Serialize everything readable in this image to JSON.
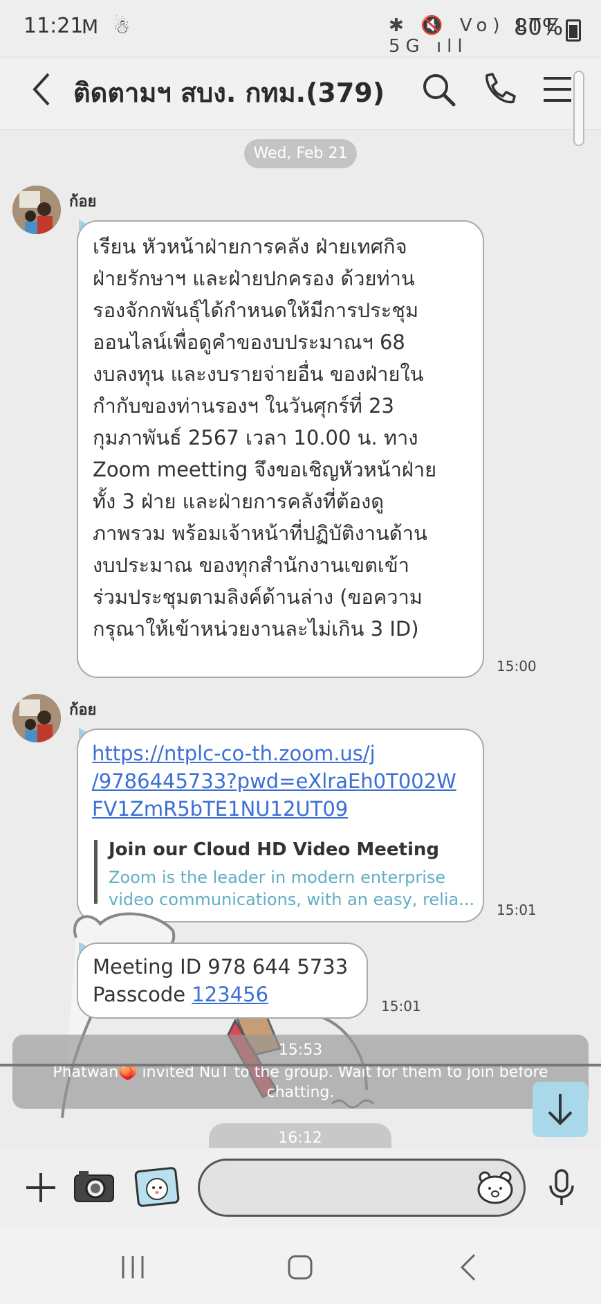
{
  "status_bar": {
    "time": "11:21",
    "left_icons": "M ☃",
    "right_icons": "✱ 🔇 Vo) LTE 5G ıll",
    "battery": "80%"
  },
  "header": {
    "title": "ติดตามฯ สบง. กทม.(379)"
  },
  "chat": {
    "date": "Wed, Feb 21",
    "messages": [
      {
        "sender": "ก้อย",
        "lines": [
          "เรียน หัวหน้าฝ่ายการคลัง  ฝ่ายเทศกิจ",
          "ฝ่ายรักษาฯ และฝ่ายปกครอง ด้วยท่าน",
          "รองจักกพันธุ์ได้กำหนดให้มีการประชุม",
          "ออนไลน์เพื่อดูคำของบประมาณฯ 68",
          "งบลงทุน และงบรายจ่ายอื่น ของฝ่ายใน",
          "กำกับของท่านรองฯ ในวันศุกร์ที่ 23",
          "กุมภาพันธ์ 2567 เวลา 10.00 น. ทาง",
          "Zoom meetting จึงขอเชิญหัวหน้าฝ่าย",
          "ทั้ง 3 ฝ่าย และฝ่ายการคลังที่ต้องดู",
          "ภาพรวม พร้อมเจ้าหน้าที่ปฏิบัติงานด้าน",
          "งบประมาณ ของทุกสำนักงานเขตเข้า",
          "ร่วมประชุมตามลิงค์ด้านล่าง (ขอความ",
          "กรุณาให้เข้าหน่วยงานละไม่เกิน 3 ID)"
        ],
        "time": "15:00"
      },
      {
        "sender": "ก้อย",
        "link_lines": [
          "https://ntplc-co-th.zoom.us/j",
          "/9786445733?pwd=eXlraEh0T002W",
          "FV1ZmR5bTE1NU12UT09"
        ],
        "preview_title": "Join our Cloud HD Video Meeting",
        "preview_desc_1": "Zoom is the leader in modern enterprise",
        "preview_desc_2": "video communications, with an easy, relia...",
        "time": "15:01"
      },
      {
        "line1": "Meeting ID 978 644 5733",
        "passcode_label": "Passcode ",
        "passcode_value": "123456",
        "time": "15:01"
      }
    ],
    "system": {
      "time": "15:53",
      "text": "Phatwan🍑 invited NüT to the group. Wait for them to join before chatting."
    },
    "next_time": "16:12"
  },
  "colors": {
    "link": "#3b6fd6",
    "preview_desc": "#62aec4",
    "scroll_button": "#a8d8ea"
  }
}
